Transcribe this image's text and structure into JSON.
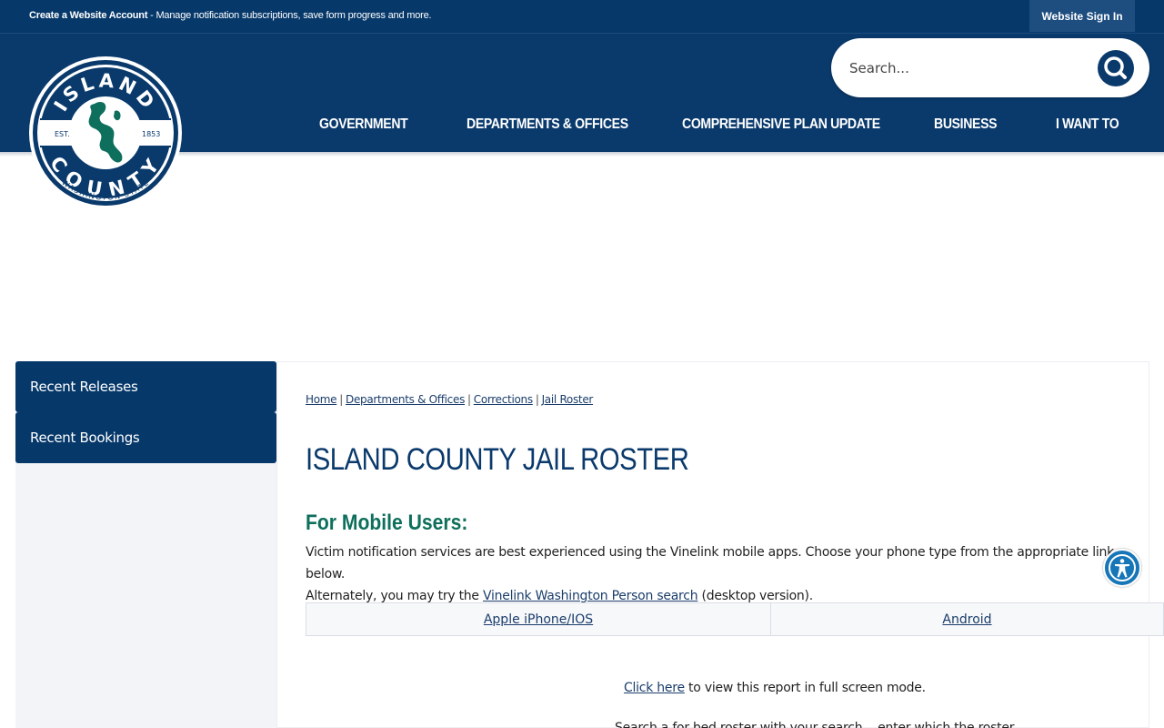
{
  "topbar": {
    "create_account_label": "Create a Website Account",
    "create_account_desc": " - Manage notification subscriptions, save form progress and more.",
    "sign_in_label": "Website Sign In"
  },
  "logo": {
    "top_text": "ISLAND",
    "bottom_text": "COUNTY",
    "ring_text": "WASHINGTON STATE",
    "est_label": "EST.",
    "year": "1853"
  },
  "search": {
    "placeholder": "Search...",
    "icon": "search-icon"
  },
  "nav": {
    "items": [
      {
        "label": "GOVERNMENT"
      },
      {
        "label": "DEPARTMENTS & OFFICES"
      },
      {
        "label": "COMPREHENSIVE PLAN UPDATE"
      },
      {
        "label": "BUSINESS"
      },
      {
        "label": "I WANT TO"
      }
    ]
  },
  "sidebar": {
    "items": [
      {
        "label": "Recent Releases"
      },
      {
        "label": "Recent Bookings"
      }
    ]
  },
  "breadcrumb": {
    "items": [
      {
        "label": "Home"
      },
      {
        "label": "Departments & Offices"
      },
      {
        "label": "Corrections"
      },
      {
        "label": "Jail Roster"
      }
    ],
    "separator": "|"
  },
  "main": {
    "title": "ISLAND COUNTY JAIL ROSTER",
    "mobile_heading": "For Mobile Users:",
    "para_line1": "Victim notification services are best experienced using the Vinelink mobile apps.  Choose your phone type from the appropriate link below.",
    "para_line2_prefix": "Alternately, you may try the ",
    "vinelink_link": "Vinelink Washington Person search",
    "para_line2_suffix": " (desktop version).",
    "apps": [
      {
        "label": "Apple iPhone/IOS"
      },
      {
        "label": "Android"
      }
    ],
    "full_screen_link": "Click here",
    "full_screen_text": " to view this report in full screen mode.",
    "cutoff_text": "Search a for bed roster with your search... enter which the roster"
  },
  "colors": {
    "navy": "#06386a",
    "header_blue": "#0a3a6c",
    "teal_heading": "#0e6f5c",
    "link": "#1a3d6b",
    "a11y_blue": "#1676b8"
  },
  "accessibility": {
    "icon": "accessibility-icon"
  }
}
